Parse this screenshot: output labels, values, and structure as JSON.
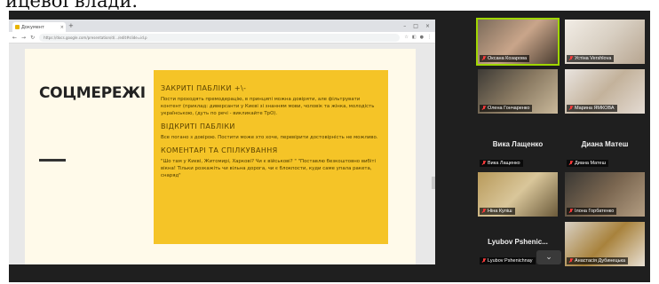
{
  "caption": "ицевої влади.",
  "browser": {
    "tab_label": "Документ",
    "tab_close": "×",
    "new_tab": "+",
    "url": "https://docs.google.com/presentation/d/.../edit#slide=id.p",
    "window_controls": [
      "–",
      "□",
      "×"
    ]
  },
  "slide": {
    "title": "СОЦМЕРЕЖІ",
    "sections": [
      {
        "heading": "ЗАКРИТІ ПАБЛІКИ +\\-",
        "body": "Пости проходять премодерацію, в принципі можна довіряти, але фільтрувати контент (приклад: диверсанти у Києві зі знанням мови, чоловік та жінка, молодість українською, (дуть по речі - викликайте ТрО)."
      },
      {
        "heading": "ВІДКРИТІ ПАБЛІКИ",
        "body": "Все погано з довірою. Постити може хто хоче, перевірити достовірність не можливо."
      },
      {
        "heading": "КОМЕНТАРІ ТА СПІЛКУВАННЯ",
        "body": "\"Шо там у Києві, Житомирі, Харкові? Чи є військові? \" \"Поставлю безкоштовно вибіті вікна! Тільки розкажіть чи вільна дорога, чи є блокпости, куди саме упала ракета, снаряд\""
      }
    ]
  },
  "participants": [
    {
      "name": "Оксана Козарова",
      "video": true,
      "muted": true,
      "active": true
    },
    {
      "name": "Устіна Vershlova",
      "video": true,
      "muted": true
    },
    {
      "name": "Олена Гончаренко",
      "video": true,
      "muted": true
    },
    {
      "name": "Марина ЯМКОВА",
      "video": true,
      "muted": true
    },
    {
      "name": "Вика Лащенко",
      "video": false,
      "muted": true
    },
    {
      "name": "Диана Матеш",
      "video": false,
      "muted": true
    },
    {
      "name": "Ніна Куліш",
      "video": true,
      "muted": true
    },
    {
      "name": "Ілона Горбатенко",
      "video": true,
      "muted": true
    },
    {
      "name": "Lyubov Pshenic...",
      "tag": "Lyubov Pshenichnay",
      "video": false,
      "muted": true
    },
    {
      "name": "Анастасія Дубинецька",
      "video": true,
      "muted": true
    }
  ],
  "chevron": "⌄"
}
